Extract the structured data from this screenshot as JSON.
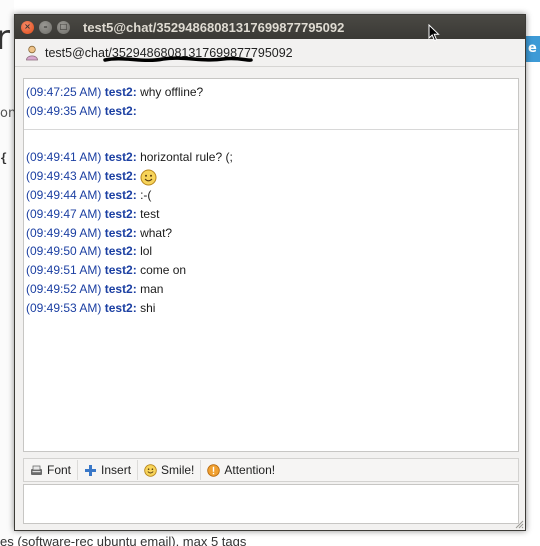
{
  "background": {
    "big_letter": "r",
    "small_text_1": "on",
    "small_text_2": "{ }",
    "right_button_label": "e",
    "bottom_text": "es (software-rec ubuntu email), max 5 tags"
  },
  "window": {
    "title": "test5@chat/35294868081317699877795092",
    "buttons": {
      "close": "×",
      "minimize": "–",
      "maximize": "□"
    }
  },
  "header": {
    "contact": "test5@chat/35294868081317699877795092",
    "icon": "person-icon"
  },
  "messages": [
    {
      "time": "(09:47:25 AM)",
      "nick": "test2:",
      "text": "why offline?"
    },
    {
      "time": "(09:49:35 AM)",
      "nick": "test2:",
      "text": ""
    },
    {
      "time": "(09:49:41 AM)",
      "nick": "test2:",
      "text": "horizontal rule? (;"
    },
    {
      "time": "(09:49:43 AM)",
      "nick": "test2:",
      "text": "",
      "emoticon": "smile-emoticon"
    },
    {
      "time": "(09:49:44 AM)",
      "nick": "test2:",
      "text": ":-("
    },
    {
      "time": "(09:49:47 AM)",
      "nick": "test2:",
      "text": "test"
    },
    {
      "time": "(09:49:49 AM)",
      "nick": "test2:",
      "text": "what?"
    },
    {
      "time": "(09:49:50 AM)",
      "nick": "test2:",
      "text": "lol"
    },
    {
      "time": "(09:49:51 AM)",
      "nick": "test2:",
      "text": "come on"
    },
    {
      "time": "(09:49:52 AM)",
      "nick": "test2:",
      "text": "man"
    },
    {
      "time": "(09:49:53 AM)",
      "nick": "test2:",
      "text": "shi"
    }
  ],
  "toolbar": {
    "font": {
      "label": "Font",
      "icon": "font-icon"
    },
    "insert": {
      "label": "Insert",
      "icon": "plus-icon"
    },
    "smile": {
      "label": "Smile!",
      "icon": "smiley-icon"
    },
    "attention": {
      "label": "Attention!",
      "icon": "attention-icon"
    }
  },
  "colors": {
    "titlebar": "#3c3b37",
    "close_button": "#df4a16",
    "timestamp": "#1b3fa2",
    "window_bg": "#f2f1f0"
  }
}
